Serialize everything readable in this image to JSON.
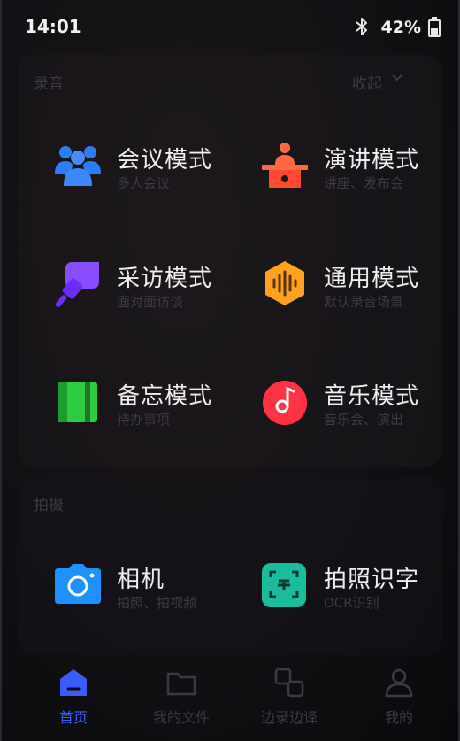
{
  "status_bar": {
    "time": "14:01",
    "battery": "42%",
    "battery_level": 0.42
  },
  "recording": {
    "section_title": "录音",
    "collapse_label": "收起",
    "modes": [
      {
        "name": "会议模式",
        "desc": "多人会议",
        "icon": "people-icon",
        "color": "#2f7bff"
      },
      {
        "name": "演讲模式",
        "desc": "讲座、发布会",
        "icon": "podium-icon",
        "color": "#ff5a3c"
      },
      {
        "name": "采访模式",
        "desc": "面对面访谈",
        "icon": "microphone-icon",
        "color": "#7b3cff"
      },
      {
        "name": "通用模式",
        "desc": "默认录音场景",
        "icon": "soundwave-icon",
        "color": "#ff9d1c"
      },
      {
        "name": "备忘模式",
        "desc": "待办事项",
        "icon": "notebook-icon",
        "color": "#2ecc40"
      },
      {
        "name": "音乐模式",
        "desc": "音乐会、演出",
        "icon": "music-disc-icon",
        "color": "#ff3344"
      }
    ]
  },
  "shooting": {
    "section_title": "拍摄",
    "modes": [
      {
        "name": "相机",
        "desc": "拍照、拍视频",
        "icon": "camera-icon",
        "color": "#1e90ff"
      },
      {
        "name": "拍照识字",
        "desc": "OCR识别",
        "icon": "scan-text-icon",
        "color": "#1abc9c"
      }
    ]
  },
  "nav": [
    {
      "label": "首页",
      "icon": "home-icon",
      "active": true
    },
    {
      "label": "我的文件",
      "icon": "folder-icon",
      "active": false
    },
    {
      "label": "边录边译",
      "icon": "translate-icon",
      "active": false
    },
    {
      "label": "我的",
      "icon": "profile-icon",
      "active": false
    }
  ]
}
